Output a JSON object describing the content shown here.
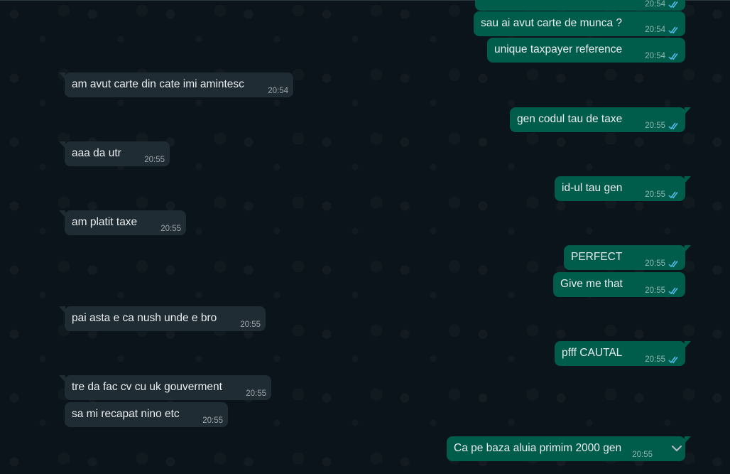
{
  "messages": [
    {
      "text": "",
      "time": "20:54",
      "dir": "out"
    },
    {
      "text": "sau ai avut carte de munca ?",
      "time": "20:54",
      "dir": "out"
    },
    {
      "text": "unique taxpayer reference",
      "time": "20:54",
      "dir": "out"
    },
    {
      "text": "am avut carte din cate imi amintesc",
      "time": "20:54",
      "dir": "in"
    },
    {
      "text": "gen codul tau de taxe",
      "time": "20:55",
      "dir": "out"
    },
    {
      "text": "aaa da utr",
      "time": "20:55",
      "dir": "in"
    },
    {
      "text": "id-ul tau gen",
      "time": "20:55",
      "dir": "out"
    },
    {
      "text": "am platit taxe",
      "time": "20:55",
      "dir": "in"
    },
    {
      "text": "PERFECT",
      "time": "20:55",
      "dir": "out"
    },
    {
      "text": "Give me that",
      "time": "20:55",
      "dir": "out"
    },
    {
      "text": "pai asta e ca nush unde e bro",
      "time": "20:55",
      "dir": "in"
    },
    {
      "text": "pfff CAUTAL",
      "time": "20:55",
      "dir": "out"
    },
    {
      "text": "tre da fac cv cu uk gouverment",
      "time": "20:55",
      "dir": "in"
    },
    {
      "text": "sa mi recapat nino etc",
      "time": "20:55",
      "dir": "in"
    },
    {
      "text": "Ca pe baza aluia primim 2000 gen",
      "time": "20:55",
      "dir": "out"
    }
  ],
  "icons": {
    "read_receipt": "double-check-icon",
    "scroll_down": "chevron-down-icon"
  },
  "colors": {
    "background": "#0b141a",
    "outgoing_bubble": "#005c4b",
    "incoming_bubble": "#202c33",
    "text": "#e9edef",
    "read_tick": "#53bdeb"
  }
}
